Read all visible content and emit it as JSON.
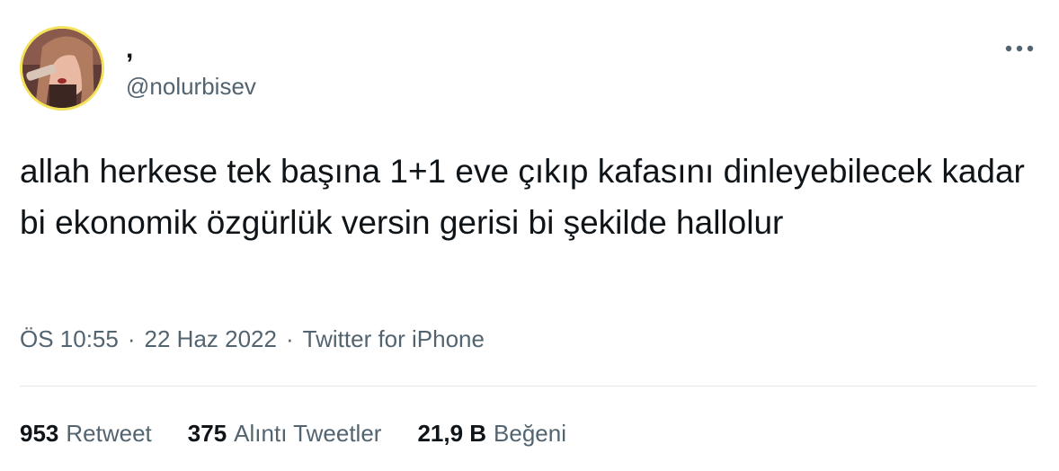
{
  "user": {
    "display_name": ",",
    "handle": "@nolurbisev"
  },
  "tweet": {
    "text": "allah herkese tek başına 1+1 eve çıkıp kafasını dinleyebilecek kadar bi ekonomik özgürlük versin gerisi bi şekilde hallolur",
    "time": "ÖS 10:55",
    "date": "22 Haz 2022",
    "separator": "·",
    "source": "Twitter for iPhone"
  },
  "stats": {
    "retweets": {
      "count": "953",
      "label": "Retweet"
    },
    "quotes": {
      "count": "375",
      "label": "Alıntı Tweetler"
    },
    "likes": {
      "count": "21,9 B",
      "label": "Beğeni"
    }
  },
  "icons": {
    "more": "more-horizontal-icon",
    "avatar": "avatar"
  },
  "colors": {
    "text_primary": "#0f1419",
    "text_secondary": "#536471",
    "divider": "#e3e7ea",
    "avatar_ring": "#f3e25a"
  }
}
